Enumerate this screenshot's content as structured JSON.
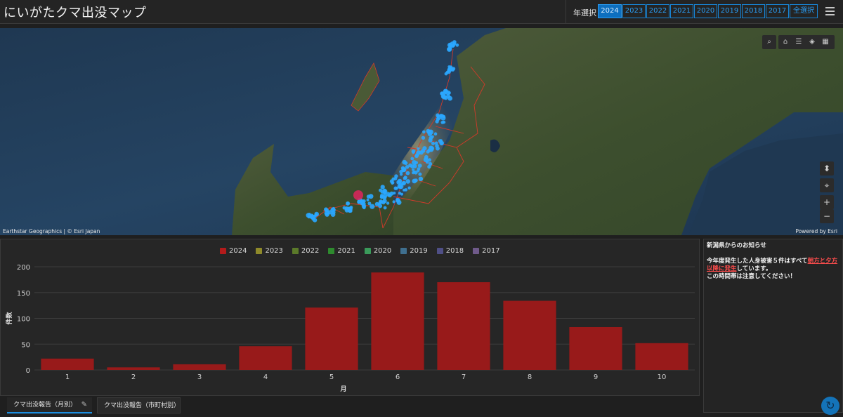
{
  "app": {
    "title": "にいがたクマ出没マップ"
  },
  "year_select": {
    "label": "年選択",
    "buttons": [
      "2024",
      "2023",
      "2022",
      "2021",
      "2020",
      "2019",
      "2018",
      "2017",
      "全選択"
    ],
    "active": "2024"
  },
  "map": {
    "attribution_left": "Earthstar Geographics | © Esri Japan",
    "attribution_right": "Powered by Esri",
    "tools_top": [
      "search-icon"
    ],
    "tools_right": [
      "home-icon",
      "list-icon",
      "layers-icon",
      "basemap-gallery-icon"
    ],
    "nav": [
      "compass-icon",
      "locate-icon",
      "zoom-in-icon",
      "zoom-out-icon"
    ],
    "nav_symbols": {
      "zoom_in": "+",
      "zoom_out": "−"
    },
    "colors": {
      "sightings": "#2aa7ff",
      "highlight": "#e0245e",
      "boundary": "#d23a2a"
    }
  },
  "chart_data": {
    "type": "bar",
    "categories": [
      "1",
      "2",
      "3",
      "4",
      "5",
      "6",
      "7",
      "8",
      "9",
      "10"
    ],
    "series": [
      {
        "name": "2024",
        "values": [
          22,
          5,
          11,
          46,
          121,
          189,
          170,
          134,
          83,
          52
        ]
      }
    ],
    "legend": [
      {
        "name": "2024",
        "color": "#b31b1b"
      },
      {
        "name": "2023",
        "color": "#8f8a2a"
      },
      {
        "name": "2022",
        "color": "#5b7a2a"
      },
      {
        "name": "2021",
        "color": "#2e8a2e"
      },
      {
        "name": "2020",
        "color": "#3a9a5a"
      },
      {
        "name": "2019",
        "color": "#3f6f8f"
      },
      {
        "name": "2018",
        "color": "#4f4f86"
      },
      {
        "name": "2017",
        "color": "#6f5a8a"
      }
    ],
    "legend_placement": "top-center",
    "xlabel": "月",
    "ylabel": "件数",
    "ylim": [
      0,
      200
    ],
    "yticks": [
      0,
      50,
      100,
      150,
      200
    ],
    "grid": true,
    "bar_color": "#981a1a"
  },
  "notice": {
    "title": "新潟県からのお知らせ",
    "line1_before": "今年度発生した人身被害５件はすべて",
    "line1_red": "朝方と夕方以降に発生",
    "line1_after": "しています。",
    "line2": "この時間帯は注意してください！"
  },
  "tabs": {
    "active": "クマ出没報告（月別）",
    "inactive": "クマ出没報告（市町村別）"
  }
}
